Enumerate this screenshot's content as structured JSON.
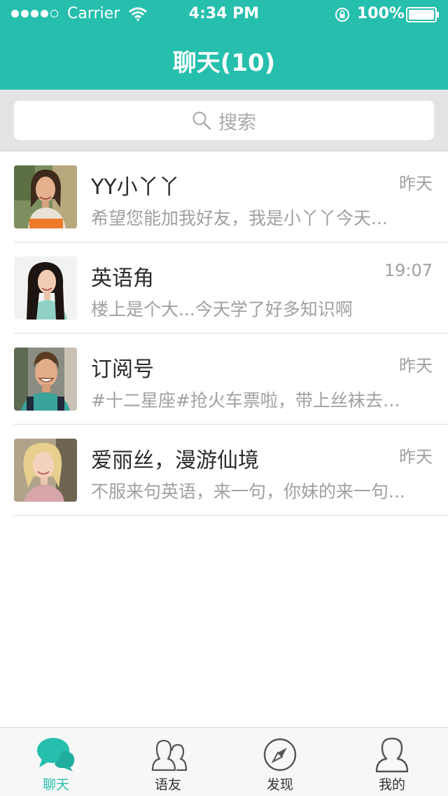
{
  "status_bar": {
    "carrier": "Carrier",
    "time": "4:34 PM",
    "battery": "100%"
  },
  "header": {
    "title": "聊天(10)"
  },
  "search": {
    "placeholder": "搜索"
  },
  "chats": [
    {
      "name": "YY小丫丫",
      "time": "昨天",
      "preview": "希望您能加我好友，我是小丫丫今天...",
      "avatar": "woman-headset-avatar"
    },
    {
      "name": "英语角",
      "time": "19:07",
      "preview": "楼上是个大...今天学了好多知识啊",
      "avatar": "woman-smiling-avatar"
    },
    {
      "name": "订阅号",
      "time": "昨天",
      "preview": "#十二星座#抢火车票啦，带上丝袜去排队...",
      "avatar": "man-smiling-avatar"
    },
    {
      "name": "爱丽丝，漫游仙境",
      "time": "昨天",
      "preview": "不服来句英语，来一句，你妹的来一句...",
      "avatar": "blonde-woman-avatar"
    }
  ],
  "tabs": [
    {
      "label": "聊天",
      "icon": "chat-bubbles-icon",
      "active": true
    },
    {
      "label": "语友",
      "icon": "friends-icon",
      "active": false
    },
    {
      "label": "发现",
      "icon": "compass-icon",
      "active": false
    },
    {
      "label": "我的",
      "icon": "person-icon",
      "active": false
    }
  ],
  "colors": {
    "accent": "#26bfad",
    "search_bg": "#e4e4e4",
    "muted_text": "#a0a0a0"
  }
}
